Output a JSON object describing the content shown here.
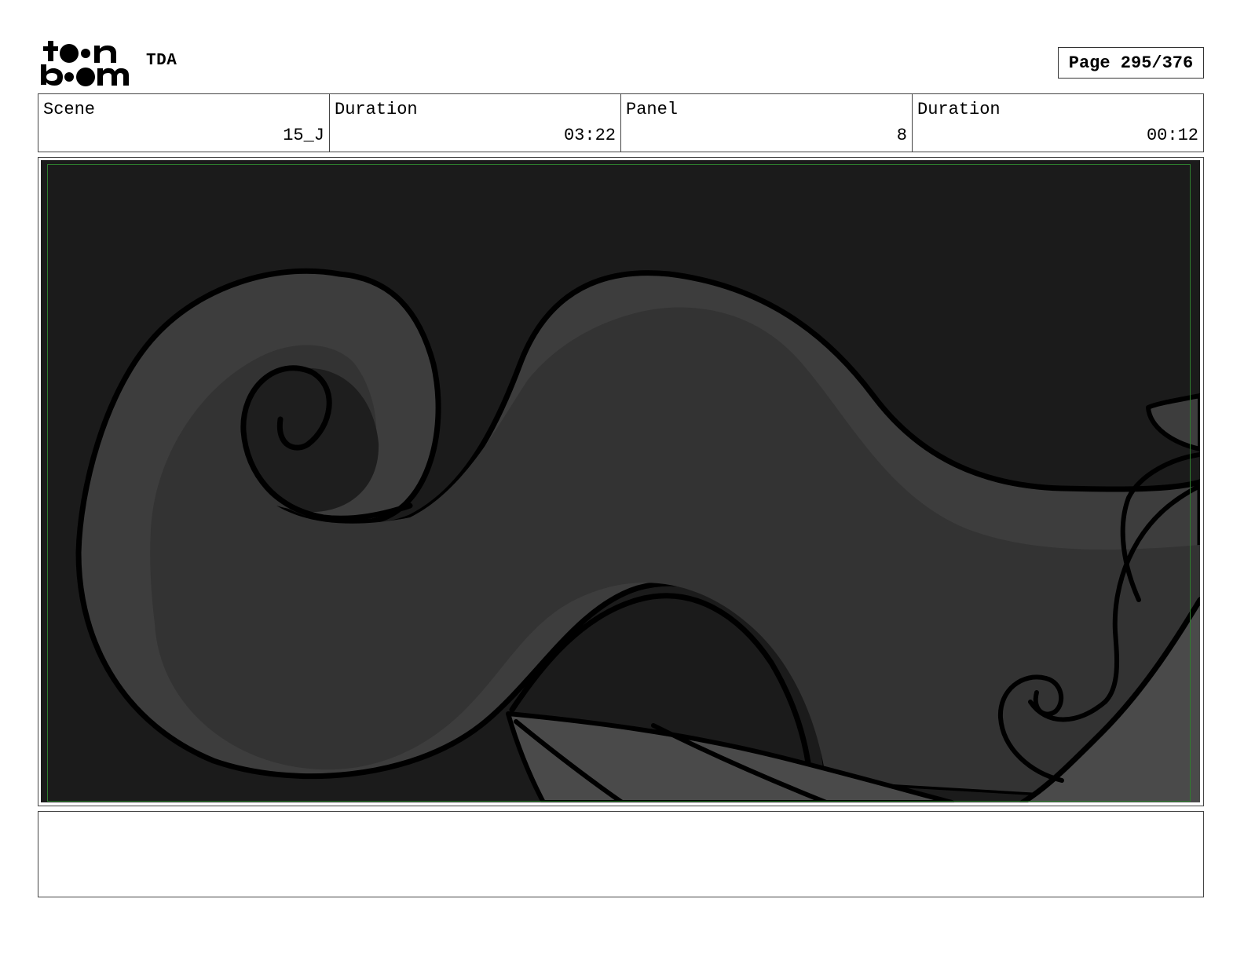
{
  "header": {
    "logo_icon": "toon-boom-logo-icon",
    "logo_text_line1": "toon",
    "logo_text_line2": "boom",
    "project_title": "TDA",
    "page_label": "Page 295/376"
  },
  "info": [
    {
      "label": "Scene",
      "value": "15_J"
    },
    {
      "label": "Duration",
      "value": "03:22"
    },
    {
      "label": "Panel",
      "value": "8"
    },
    {
      "label": "Duration",
      "value": "00:12"
    }
  ],
  "panel": {
    "background_color": "#1b1b1b",
    "shape_color": "#3d3d3d",
    "shape_dark_color": "#333333",
    "outline_color": "#000000",
    "safe_frame_color": "#2e7d2e"
  },
  "notes": {
    "text": ""
  }
}
